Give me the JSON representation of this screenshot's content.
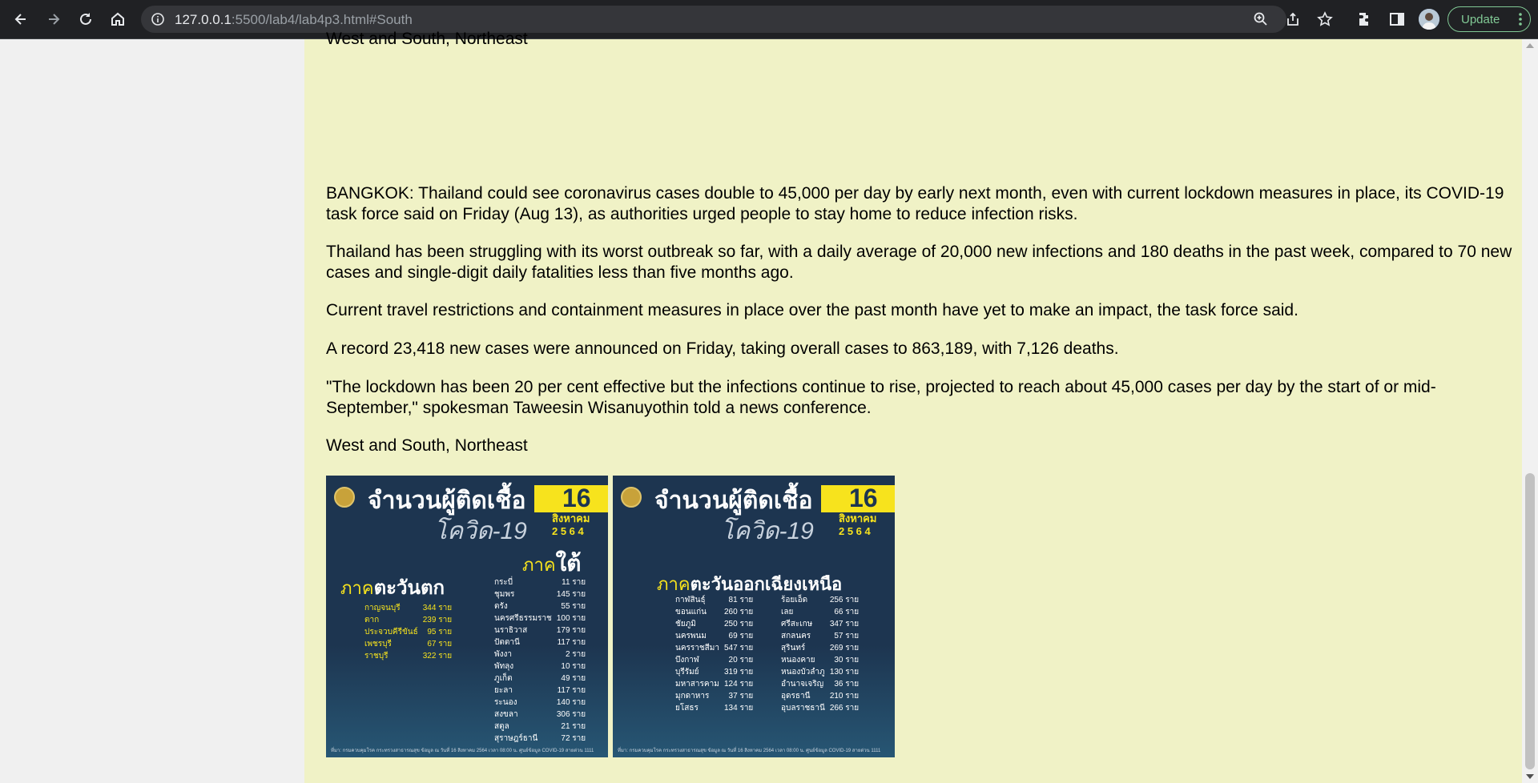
{
  "browser": {
    "url_host": "127.0.0.1",
    "url_rest": ":5500/lab4/lab4p3.html#South",
    "update_label": "Update"
  },
  "article": {
    "clipped_line": "West and South, Northeast",
    "paragraphs": [
      "BANGKOK: Thailand could see coronavirus cases double to 45,000 per day by early next month, even with current lockdown measures in place, its COVID-19 task force said on Friday (Aug 13), as authorities urged people to stay home to reduce infection risks.",
      "Thailand has been struggling with its worst outbreak so far, with a daily average of 20,000 new infections and 180 deaths in the past week, compared to 70 new cases and single-digit daily fatalities less than five months ago.",
      "Current travel restrictions and containment measures in place over the past month have yet to make an impact, the task force said.",
      "A record 23,418 new cases were announced on Friday, taking overall cases to 863,189, with 7,126 deaths.",
      "\"The lockdown has been 20 per cent effective but the infections continue to rise, projected to reach about 45,000 cases per day by the start of or mid-September,\" spokesman Taweesin Wisanuyothin told a news conference.",
      "West and South, Northeast"
    ]
  },
  "infographics": [
    {
      "title": "จำนวนผู้ติดเชื้อ",
      "subtitle": "โควิด-19",
      "day": "16",
      "month": "สิงหาคม",
      "year": "2 5 6 4",
      "region_prefix": "ภาค",
      "region_west": "ตะวันตก",
      "region_south": "ใต้",
      "west_rows": [
        [
          "กาญจนบุรี",
          "344 ราย"
        ],
        [
          "ตาก",
          "239 ราย"
        ],
        [
          "ประจวบคีรีขันธ์",
          "95 ราย"
        ],
        [
          "เพชรบุรี",
          "67 ราย"
        ],
        [
          "ราชบุรี",
          "322 ราย"
        ]
      ],
      "south_rows": [
        [
          "กระบี่",
          "11 ราย"
        ],
        [
          "ชุมพร",
          "145 ราย"
        ],
        [
          "ตรัง",
          "55 ราย"
        ],
        [
          "นครศรีธรรมราช",
          "100 ราย"
        ],
        [
          "นราธิวาส",
          "179 ราย"
        ],
        [
          "ปัตตานี",
          "117 ราย"
        ],
        [
          "พังงา",
          "2 ราย"
        ],
        [
          "พัทลุง",
          "10 ราย"
        ],
        [
          "ภูเก็ต",
          "49 ราย"
        ],
        [
          "ยะลา",
          "117 ราย"
        ],
        [
          "ระนอง",
          "140 ราย"
        ],
        [
          "สงขลา",
          "306 ราย"
        ],
        [
          "สตูล",
          "21 ราย"
        ],
        [
          "สุราษฎร์ธานี",
          "72 ราย"
        ]
      ],
      "footer": "ที่มา: กรมควบคุมโรค กระทรวงสาธารณสุข   ข้อมูล ณ วันที่ 16 สิงหาคม 2564 เวลา 08:00 น.   ศูนย์ข้อมูล COVID-19   สายด่วน 1111"
    },
    {
      "title": "จำนวนผู้ติดเชื้อ",
      "subtitle": "โควิด-19",
      "day": "16",
      "month": "สิงหาคม",
      "year": "2 5 6 4",
      "region_prefix": "ภาค",
      "region_name": "ตะวันออกเฉียงเหนือ",
      "left_rows": [
        [
          "กาฬสินธุ์",
          "81 ราย"
        ],
        [
          "ขอนแก่น",
          "260 ราย"
        ],
        [
          "ชัยภูมิ",
          "250 ราย"
        ],
        [
          "นครพนม",
          "69 ราย"
        ],
        [
          "นครราชสีมา",
          "547 ราย"
        ],
        [
          "บึงกาฬ",
          "20 ราย"
        ],
        [
          "บุรีรัมย์",
          "319 ราย"
        ],
        [
          "มหาสารคาม",
          "124 ราย"
        ],
        [
          "มุกดาหาร",
          "37 ราย"
        ],
        [
          "ยโสธร",
          "134 ราย"
        ]
      ],
      "right_rows": [
        [
          "ร้อยเอ็ด",
          "256 ราย"
        ],
        [
          "เลย",
          "66 ราย"
        ],
        [
          "ศรีสะเกษ",
          "347 ราย"
        ],
        [
          "สกลนคร",
          "57 ราย"
        ],
        [
          "สุรินทร์",
          "269 ราย"
        ],
        [
          "หนองคาย",
          "30 ราย"
        ],
        [
          "หนองบัวลำภู",
          "130 ราย"
        ],
        [
          "อำนาจเจริญ",
          "36 ราย"
        ],
        [
          "อุดรธานี",
          "210 ราย"
        ],
        [
          "อุบลราชธานี",
          "266 ราย"
        ]
      ],
      "footer": "ที่มา: กรมควบคุมโรค กระทรวงสาธารณสุข   ข้อมูล ณ วันที่ 16 สิงหาคม 2564 เวลา 08:00 น.   ศูนย์ข้อมูล COVID-19   สายด่วน 1111"
    }
  ]
}
